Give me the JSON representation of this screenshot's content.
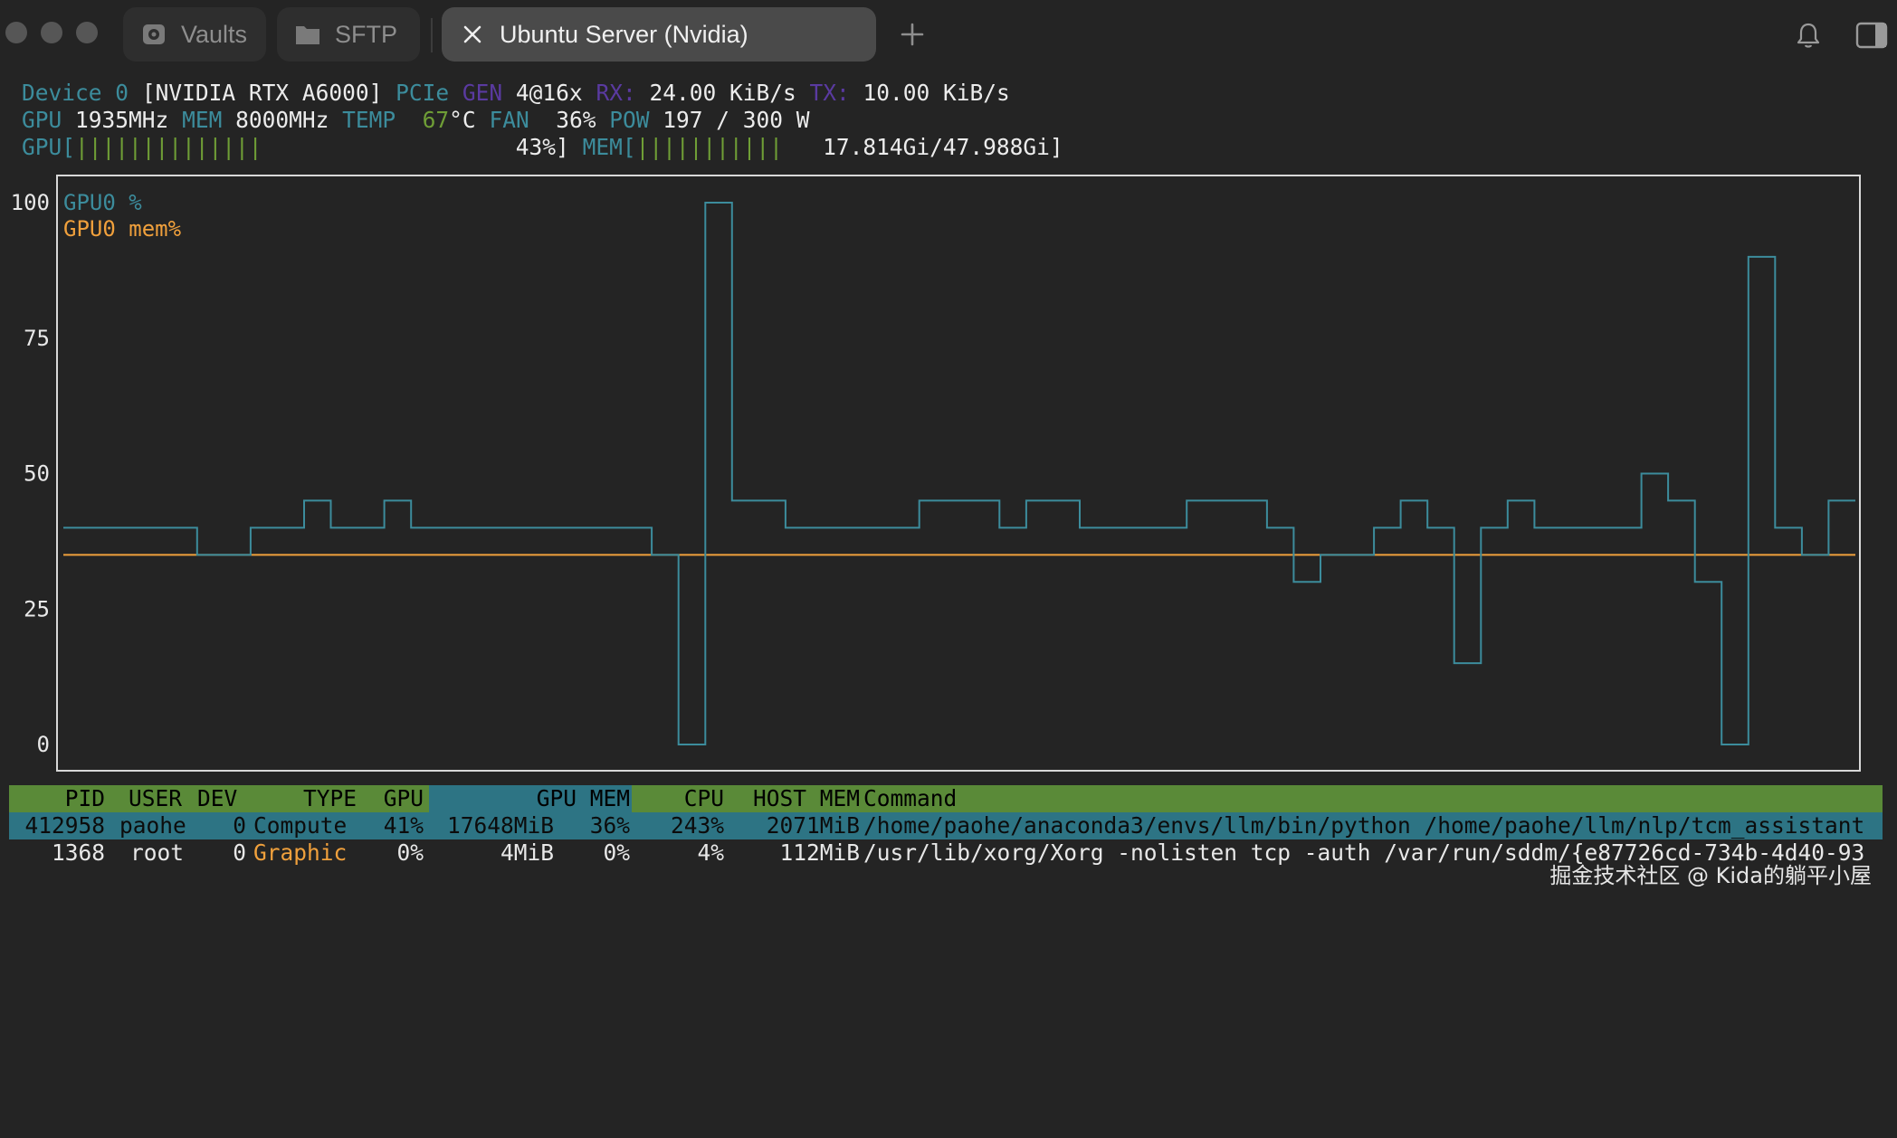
{
  "titlebar": {
    "tabs": [
      {
        "label": "Vaults",
        "icon": "vault-icon"
      },
      {
        "label": "SFTP",
        "icon": "folder-icon"
      },
      {
        "label": "Ubuntu Server (Nvidia)",
        "icon": "close-icon",
        "active": true
      }
    ],
    "new_tab_icon": "plus-icon",
    "notification_icon": "bell-icon",
    "sidebar_icon": "sidebar-toggle-icon"
  },
  "device": {
    "device_label": "Device",
    "device_index": "0",
    "name": "[NVIDIA RTX A6000]",
    "pcie_label": "PCIe",
    "gen_label": "GEN",
    "gen_value": "4@16x",
    "rx_label": "RX:",
    "rx_value": "24.00 KiB/s",
    "tx_label": "TX:",
    "tx_value": "10.00 KiB/s",
    "gpu_label": "GPU",
    "gpu_clock": "1935MHz",
    "mem_label": "MEM",
    "mem_clock": "8000MHz",
    "temp_label": "TEMP",
    "temp_value": "67",
    "temp_unit": "°C",
    "fan_label": "FAN",
    "fan_value": "36%",
    "pow_label": "POW",
    "pow_value": "197 / 300 W",
    "gpu_bar_label": "GPU[",
    "gpu_bar_fill": "||||||||||||||",
    "gpu_bar_value": "43%]",
    "gpu_bar_percent": 43,
    "mem_bar_label": "MEM[",
    "mem_bar_fill": "|||||||||||",
    "mem_bar_value": "17.814Gi/47.988Gi]"
  },
  "chart_data": {
    "type": "line",
    "ylim": [
      0,
      100
    ],
    "yticks": [
      "100",
      "75",
      "50",
      "25",
      "0"
    ],
    "grid": false,
    "legend_position": "top-left",
    "colors": {
      "gpu": "#3c8c9c",
      "mem": "#f0a03c"
    },
    "series": [
      {
        "name": "GPU0 %",
        "values": [
          40,
          40,
          40,
          40,
          40,
          35,
          35,
          40,
          40,
          45,
          40,
          40,
          45,
          40,
          40,
          40,
          40,
          40,
          40,
          40,
          40,
          40,
          35,
          0,
          100,
          45,
          45,
          40,
          40,
          40,
          40,
          40,
          45,
          45,
          45,
          40,
          45,
          45,
          40,
          40,
          40,
          40,
          45,
          45,
          45,
          40,
          30,
          35,
          35,
          40,
          45,
          40,
          15,
          40,
          45,
          40,
          40,
          40,
          40,
          50,
          45,
          30,
          0,
          90,
          40,
          35,
          45
        ]
      },
      {
        "name": "GPU0 mem%",
        "values": [
          35,
          35,
          35,
          35,
          35,
          35,
          35,
          35,
          35,
          35,
          35,
          35,
          35,
          35,
          35,
          35,
          35,
          35,
          35,
          35,
          35,
          35,
          35,
          35,
          35,
          35,
          35,
          35,
          35,
          35,
          35,
          35,
          35,
          35,
          35,
          35,
          35,
          35,
          35,
          35,
          35,
          35,
          35,
          35,
          35,
          35,
          35,
          35,
          35,
          35,
          35,
          35,
          35,
          35,
          35,
          35,
          35,
          35,
          35,
          35,
          35,
          35,
          35,
          35,
          35,
          35,
          35
        ]
      }
    ]
  },
  "processes": {
    "headers": {
      "pid": "PID",
      "user": "USER",
      "dev": "DEV",
      "type": "TYPE",
      "gpu": "GPU",
      "gpu_mem": "GPU MEM",
      "cpu": "CPU",
      "host_mem": "HOST MEM",
      "command": "Command"
    },
    "rows": [
      {
        "pid": "412958",
        "user": "paohe",
        "dev": "0",
        "type": "Compute",
        "gpu": "41%",
        "gpu_mem": "17648MiB",
        "gpu_mem_pct": "36%",
        "cpu": "243%",
        "host_mem": "2071MiB",
        "command": "/home/paohe/anaconda3/envs/llm/bin/python /home/paohe/llm/nlp/tcm_assistant"
      },
      {
        "pid": "1368",
        "user": "root",
        "dev": "0",
        "type": "Graphic",
        "gpu": "0%",
        "gpu_mem": "4MiB",
        "gpu_mem_pct": "0%",
        "cpu": "4%",
        "host_mem": "112MiB",
        "command": "/usr/lib/xorg/Xorg -nolisten tcp -auth /var/run/sddm/{e87726cd-734b-4d40-93"
      }
    ]
  },
  "watermark": "掘金技术社区 @ Kida的躺平小屋"
}
